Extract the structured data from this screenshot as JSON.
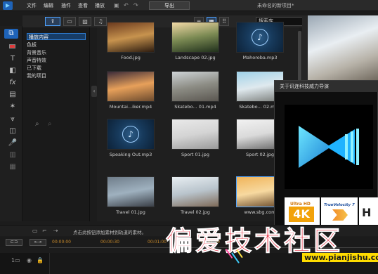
{
  "menubar": {
    "items": [
      "文件",
      "编辑",
      "插件",
      "查看",
      "播放"
    ],
    "export_label": "导出",
    "project_title": "未命名的新项目*"
  },
  "library": {
    "search_placeholder": "搜索库"
  },
  "categories": [
    "播放内容",
    "色板",
    "背景音乐",
    "声音特效",
    "已下载",
    "我的项目"
  ],
  "media": [
    {
      "caption": "Food.jpg",
      "kind": "image",
      "colors": [
        "#6b3a1e",
        "#c7934e",
        "#2d1c10"
      ]
    },
    {
      "caption": "Landscape 02.jpg",
      "kind": "image",
      "colors": [
        "#f2d9a6",
        "#7b8a53",
        "#20301c"
      ]
    },
    {
      "caption": "Mahoroba.mp3",
      "kind": "audio"
    },
    {
      "caption": "Mountai...iker.mp4",
      "kind": "image",
      "colors": [
        "#3a2a38",
        "#e7a05a",
        "#6b4a2e"
      ]
    },
    {
      "caption": "Skatebo... 01.mp4",
      "kind": "image",
      "colors": [
        "#ced3d6",
        "#8c8c84",
        "#5a5650"
      ]
    },
    {
      "caption": "Skatebo... 02.mp4",
      "kind": "image",
      "colors": [
        "#9fd1e8",
        "#dfe9ee",
        "#7a7d7a"
      ]
    },
    {
      "caption": "Speaking Out.mp3",
      "kind": "audio"
    },
    {
      "caption": "Sport 01.jpg",
      "kind": "image",
      "colors": [
        "#e9e9e9",
        "#d4d4d4",
        "#9a9a9a"
      ]
    },
    {
      "caption": "Sport 02.jpg",
      "kind": "image",
      "colors": [
        "#f2f2f2",
        "#dadada",
        "#6a6a6a"
      ]
    },
    {
      "caption": "Travel 01.jpg",
      "kind": "image",
      "colors": [
        "#6f7d8a",
        "#9fb1bf",
        "#3a3f47"
      ]
    },
    {
      "caption": "Travel 02.jpg",
      "kind": "image",
      "colors": [
        "#e8eef2",
        "#b9c4cc",
        "#7e6a58"
      ]
    },
    {
      "caption": "www.sbg.com",
      "kind": "image",
      "colors": [
        "#f0b45a",
        "#f7d9a0",
        "#6a4a2a"
      ]
    }
  ],
  "about": {
    "title": "关于讯连科技威力导演",
    "badges": {
      "ultra_hd": "Ultra HD",
      "four_k": "4K",
      "true_velocity": "TrueVelocity 7",
      "letter": "H"
    }
  },
  "timeline": {
    "hint": "点击此按钮添加素材到轨道的素材。",
    "timecodes": [
      "00:00:00",
      "00:00:30",
      "00:01:00",
      "00:01:30"
    ]
  },
  "watermark": {
    "text": "偏爱技术社区",
    "url": "www.pianjishu.com"
  }
}
